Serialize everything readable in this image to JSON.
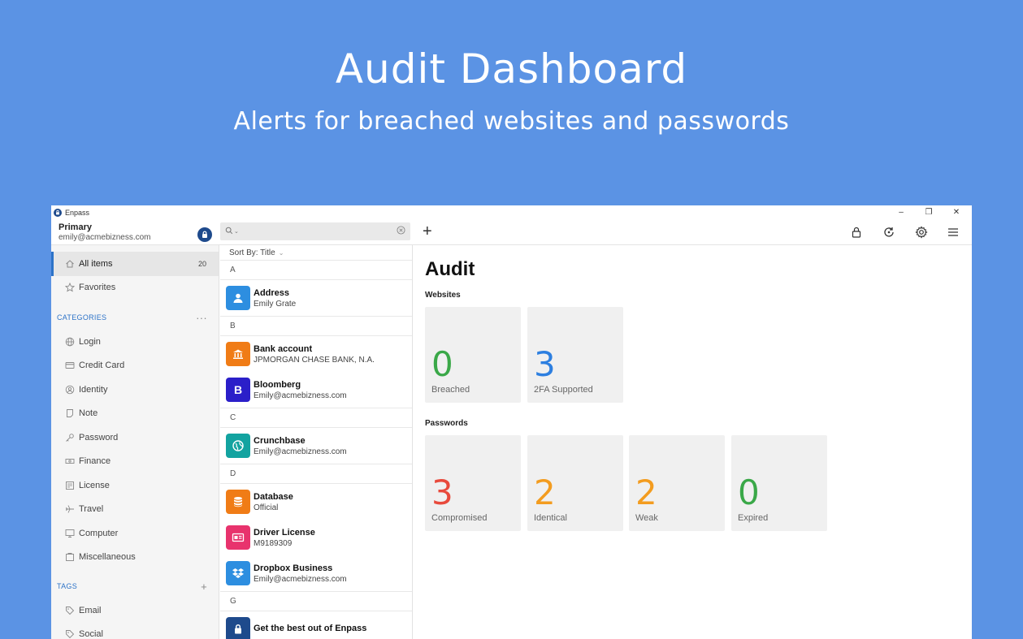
{
  "hero": {
    "title": "Audit Dashboard",
    "subtitle": "Alerts for breached websites and passwords"
  },
  "window": {
    "app_title": "Enpass",
    "controls": [
      "–",
      "❐",
      "✕"
    ]
  },
  "vault": {
    "name": "Primary",
    "email": "emily@acmebizness.com"
  },
  "search": {
    "value": "",
    "placeholder": ""
  },
  "toolbar": {
    "add_label": "+",
    "icons": [
      "lock-icon",
      "sync-icon",
      "gear-icon",
      "menu-icon"
    ]
  },
  "sidebar": {
    "all_items": {
      "label": "All items",
      "count": "20"
    },
    "favorites": {
      "label": "Favorites"
    },
    "categories_label": "CATEGORIES",
    "categories_action": "···",
    "categories": [
      {
        "label": "Login",
        "icon": "globe-icon"
      },
      {
        "label": "Credit Card",
        "icon": "credit-card-icon"
      },
      {
        "label": "Identity",
        "icon": "identity-icon"
      },
      {
        "label": "Note",
        "icon": "note-icon"
      },
      {
        "label": "Password",
        "icon": "key-icon"
      },
      {
        "label": "Finance",
        "icon": "finance-icon"
      },
      {
        "label": "License",
        "icon": "license-icon"
      },
      {
        "label": "Travel",
        "icon": "plane-icon"
      },
      {
        "label": "Computer",
        "icon": "monitor-icon"
      },
      {
        "label": "Miscellaneous",
        "icon": "misc-icon"
      }
    ],
    "tags_label": "TAGS",
    "tags_action": "+",
    "tags": [
      {
        "label": "Email",
        "icon": "tag-icon"
      },
      {
        "label": "Social",
        "icon": "tag-icon"
      }
    ]
  },
  "list": {
    "sort_label": "Sort By: Title",
    "groups": [
      {
        "letter": "A",
        "items": [
          {
            "title": "Address",
            "subtitle": "Emily Grate",
            "icon": "person-icon",
            "color": "#2d8ee0"
          }
        ]
      },
      {
        "letter": "B",
        "items": [
          {
            "title": "Bank account",
            "subtitle": "JPMORGAN CHASE BANK, N.A.",
            "icon": "bank-icon",
            "color": "#f07c16"
          },
          {
            "title": "Bloomberg",
            "subtitle": "Emily@acmebizness.com",
            "icon": "B",
            "color": "#2b1fc9"
          }
        ]
      },
      {
        "letter": "C",
        "items": [
          {
            "title": "Crunchbase",
            "subtitle": "Emily@acmebizness.com",
            "icon": "globe-icon",
            "color": "#13a3a0"
          }
        ]
      },
      {
        "letter": "D",
        "items": [
          {
            "title": "Database",
            "subtitle": "Official",
            "icon": "database-icon",
            "color": "#f07c16"
          },
          {
            "title": "Driver License",
            "subtitle": "M9189309",
            "icon": "license-card-icon",
            "color": "#e8336d"
          },
          {
            "title": "Dropbox Business",
            "subtitle": "Emily@acmebizness.com",
            "icon": "dropbox-icon",
            "color": "#2d8ee0"
          }
        ]
      },
      {
        "letter": "G",
        "items": [
          {
            "title": "Get the best out of Enpass",
            "subtitle": "",
            "icon": "enpass-icon",
            "color": "#1e4a8c"
          }
        ]
      }
    ]
  },
  "audit": {
    "title": "Audit",
    "websites_label": "Websites",
    "websites": [
      {
        "value": "0",
        "label": "Breached",
        "color": "#3aa848"
      },
      {
        "value": "3",
        "label": "2FA Supported",
        "color": "#2d7fe0"
      }
    ],
    "passwords_label": "Passwords",
    "passwords": [
      {
        "value": "3",
        "label": "Compromised",
        "color": "#e84a3c"
      },
      {
        "value": "2",
        "label": "Identical",
        "color": "#f39c1f"
      },
      {
        "value": "2",
        "label": "Weak",
        "color": "#f39c1f"
      },
      {
        "value": "0",
        "label": "Expired",
        "color": "#3aa848"
      }
    ]
  }
}
